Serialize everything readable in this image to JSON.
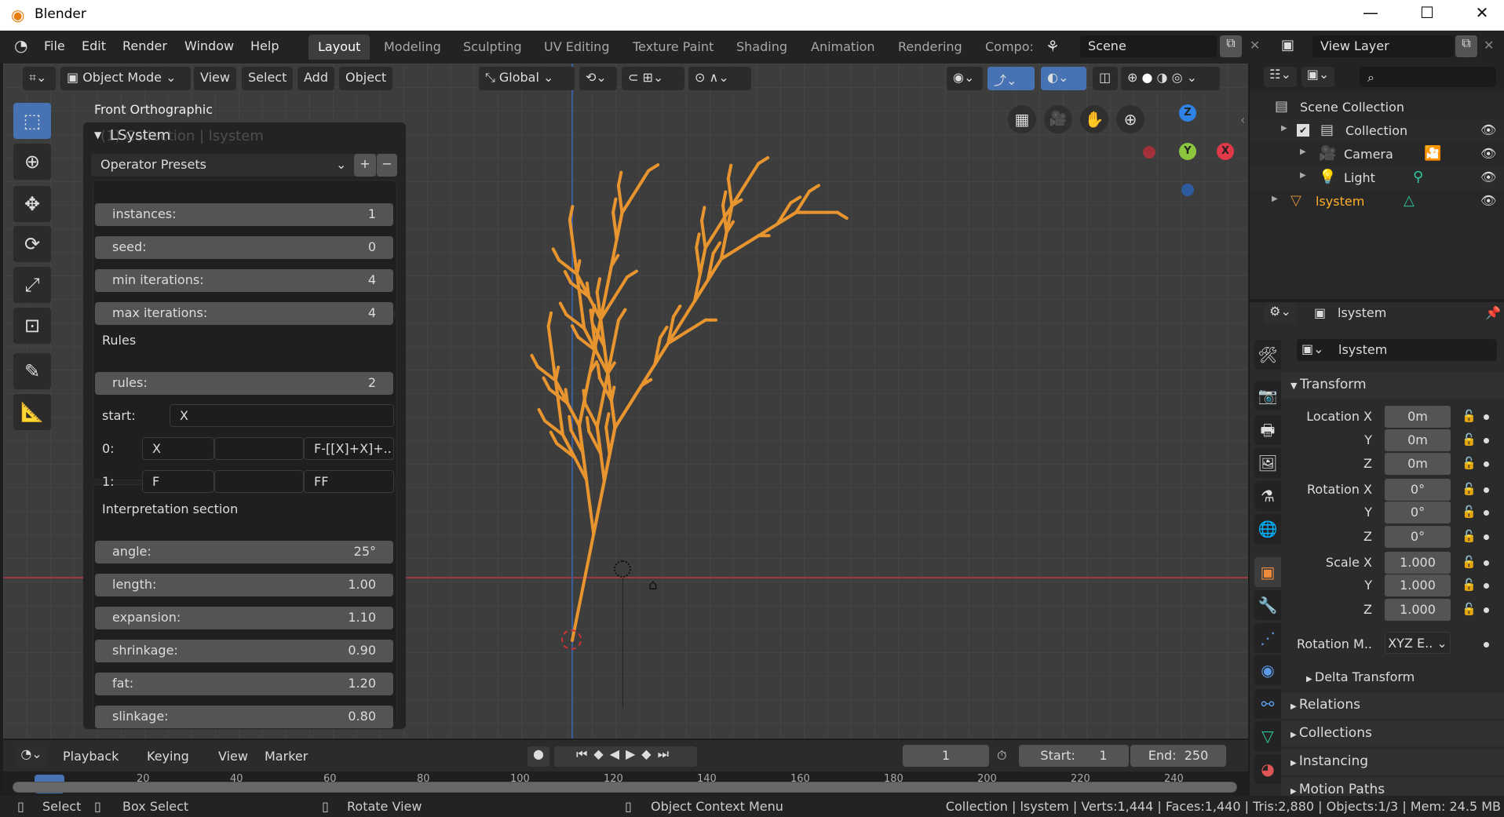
{
  "window": {
    "title": "Blender",
    "min": "—",
    "max": "☐",
    "close": "✕"
  },
  "menu": {
    "items": [
      "File",
      "Edit",
      "Render",
      "Window",
      "Help"
    ]
  },
  "workspaces": {
    "tabs": [
      "Layout",
      "Modeling",
      "Sculpting",
      "UV Editing",
      "Texture Paint",
      "Shading",
      "Animation",
      "Rendering",
      "Compo:"
    ],
    "active": "Layout"
  },
  "scene": {
    "name": "Scene",
    "view_layer": "View Layer"
  },
  "viewport_header": {
    "mode": "Object Mode",
    "menus": [
      "View",
      "Select",
      "Add",
      "Object"
    ],
    "orientation": "Global"
  },
  "viewport": {
    "view_name": "Front Orthographic",
    "overlay_text": "(1) Collection | lsystem",
    "axis_labels": {
      "x": "X",
      "y": "Y",
      "z": "Z"
    },
    "accent": "#e8952f"
  },
  "operator": {
    "title": "LSystem",
    "presets": "Operator Presets",
    "add": "+",
    "remove": "−",
    "params": [
      {
        "label": "instances:",
        "value": "1"
      },
      {
        "label": "seed:",
        "value": "0"
      },
      {
        "label": "min iterations:",
        "value": "4"
      },
      {
        "label": "max iterations:",
        "value": "4"
      }
    ],
    "rules_header": "Rules",
    "rules_count": {
      "label": "rules:",
      "value": "2"
    },
    "start": {
      "label": "start:",
      "value": "X"
    },
    "rules": [
      {
        "label": "0:",
        "from": "X",
        "to": "F-[[X]+X]+.."
      },
      {
        "label": "1:",
        "from": "F",
        "to": "FF"
      }
    ],
    "interp_header": "Interpretation section",
    "interp": [
      {
        "label": "angle:",
        "value": "25°"
      },
      {
        "label": "length:",
        "value": "1.00"
      },
      {
        "label": "expansion:",
        "value": "1.10"
      },
      {
        "label": "shrinkage:",
        "value": "0.90"
      },
      {
        "label": "fat:",
        "value": "1.20"
      },
      {
        "label": "slinkage:",
        "value": "0.80"
      }
    ]
  },
  "outliner": {
    "rows": [
      {
        "label": "Scene Collection",
        "icon": "scene-collection-icon"
      },
      {
        "label": "Collection",
        "icon": "collection-icon"
      },
      {
        "label": "Camera",
        "icon": "camera-icon"
      },
      {
        "label": "Light",
        "icon": "light-icon"
      },
      {
        "label": "lsystem",
        "icon": "mesh-icon",
        "active": true
      }
    ]
  },
  "properties": {
    "object_name": "lsystem",
    "name_field": "lsystem",
    "transform": "Transform",
    "rows": [
      {
        "label": "Location X",
        "value": "0m"
      },
      {
        "label": "Y",
        "value": "0m"
      },
      {
        "label": "Z",
        "value": "0m"
      },
      {
        "label": "Rotation X",
        "value": "0°"
      },
      {
        "label": "Y",
        "value": "0°"
      },
      {
        "label": "Z",
        "value": "0°"
      },
      {
        "label": "Scale X",
        "value": "1.000"
      },
      {
        "label": "Y",
        "value": "1.000"
      },
      {
        "label": "Z",
        "value": "1.000"
      }
    ],
    "rotation_mode": {
      "label": "Rotation M..",
      "value": "XYZ E.."
    },
    "delta": "Delta Transform",
    "sections": [
      "Relations",
      "Collections",
      "Instancing",
      "Motion Paths"
    ]
  },
  "timeline": {
    "menus": [
      "Playback",
      "Keying",
      "View",
      "Marker"
    ],
    "current_frame": "1",
    "start_label": "Start:",
    "start": "1",
    "end_label": "End:",
    "end": "250",
    "ticks": [
      "20",
      "40",
      "60",
      "80",
      "100",
      "120",
      "140",
      "160",
      "180",
      "200",
      "220",
      "240"
    ]
  },
  "statusbar": {
    "select": "Select",
    "box_select": "Box Select",
    "rotate": "Rotate View",
    "context": "Object Context Menu",
    "stats": "Collection | lsystem | Verts:1,444 | Faces:1,440 | Tris:2,880 | Objects:1/3 | Mem: 24.5 MB"
  }
}
